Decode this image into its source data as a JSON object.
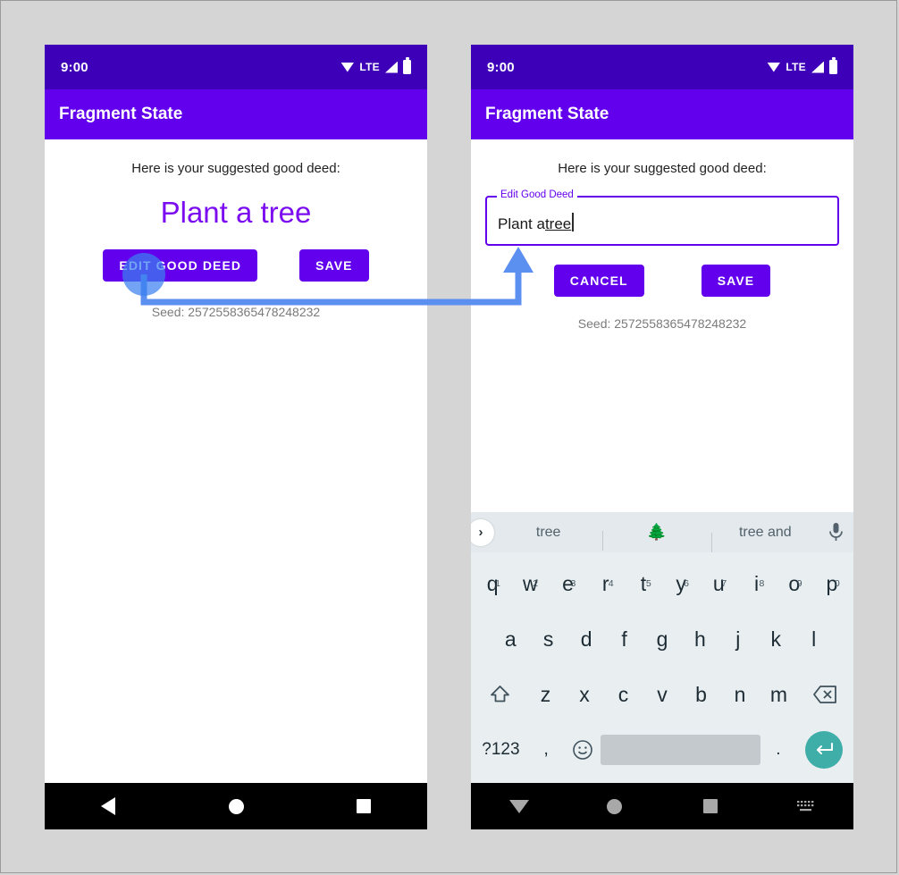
{
  "meta": {
    "accent_purple": "#6200ee",
    "status_purple": "#3d00b8",
    "headline_purple": "#7c0cf0",
    "annotation_blue": "#5b8ff0",
    "keyboard_bg": "#e9eef1",
    "enter_teal": "#3fada8",
    "page_bg": "#d5d5d5"
  },
  "status_bar": {
    "time": "9:00",
    "network_label": "LTE",
    "icons": [
      "wifi-icon",
      "lte-label",
      "signal-icon",
      "battery-icon"
    ]
  },
  "app_bar": {
    "title": "Fragment State"
  },
  "screens": {
    "left": {
      "prompt": "Here is your suggested good deed:",
      "deed": "Plant a tree",
      "buttons": [
        {
          "label": "EDIT GOOD DEED",
          "name": "edit-good-deed-button"
        },
        {
          "label": "SAVE",
          "name": "save-button"
        }
      ],
      "seed": "Seed: 2572558365478248232",
      "nav": [
        "back-icon",
        "home-icon",
        "recents-icon"
      ]
    },
    "right": {
      "prompt": "Here is your suggested good deed:",
      "text_field": {
        "label": "Edit Good Deed",
        "value_plain": "Plant a ",
        "value_composing": "tree"
      },
      "buttons": [
        {
          "label": "CANCEL",
          "name": "cancel-button"
        },
        {
          "label": "SAVE",
          "name": "save-button"
        }
      ],
      "seed": "Seed: 2572558365478248232",
      "nav": [
        "hide-keyboard-icon",
        "home-icon",
        "recents-icon",
        "switch-keyboard-icon"
      ]
    }
  },
  "keyboard": {
    "suggestions": [
      {
        "label": "tree",
        "name": "suggestion-tree"
      },
      {
        "label": "🌲",
        "name": "suggestion-tree-emoji"
      },
      {
        "label": "tree and",
        "name": "suggestion-tree-and"
      }
    ],
    "expand_icon": "chevron-right-icon",
    "mic_icon": "microphone-icon",
    "row1": [
      {
        "key": "q",
        "num": "1"
      },
      {
        "key": "w",
        "num": "2"
      },
      {
        "key": "e",
        "num": "3"
      },
      {
        "key": "r",
        "num": "4"
      },
      {
        "key": "t",
        "num": "5"
      },
      {
        "key": "y",
        "num": "6"
      },
      {
        "key": "u",
        "num": "7"
      },
      {
        "key": "i",
        "num": "8"
      },
      {
        "key": "o",
        "num": "9"
      },
      {
        "key": "p",
        "num": "0"
      }
    ],
    "row2": [
      "a",
      "s",
      "d",
      "f",
      "g",
      "h",
      "j",
      "k",
      "l"
    ],
    "row3": [
      "z",
      "x",
      "c",
      "v",
      "b",
      "n",
      "m"
    ],
    "shift_icon": "shift-icon",
    "backspace_icon": "backspace-icon",
    "row4": {
      "symbols_label": "?123",
      "comma_label": ",",
      "emoji_icon": "emoji-icon",
      "space_label": "",
      "period_label": ".",
      "enter_icon": "enter-icon"
    }
  },
  "annotation": {
    "touch_indicator_label": "touch-indicator",
    "arrow_label": "flow-arrow-edit-to-textfield"
  }
}
